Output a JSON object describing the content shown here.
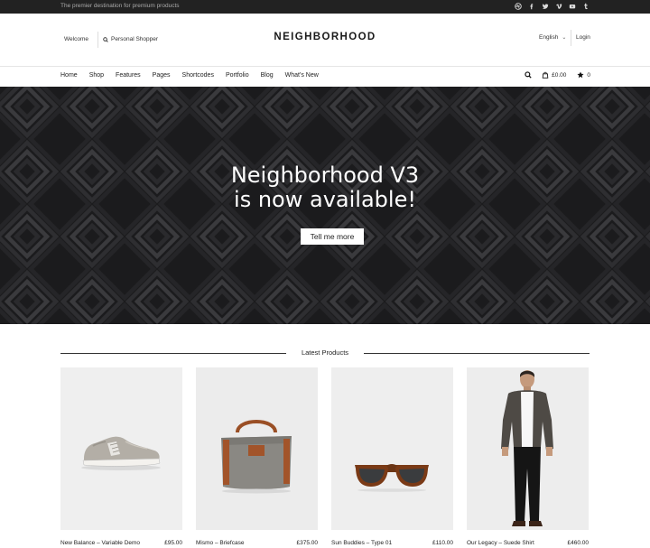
{
  "topbar": {
    "tagline": "The premier destination for premium products",
    "social_icons": [
      "dribbble-icon",
      "facebook-icon",
      "twitter-icon",
      "vimeo-icon",
      "youtube-icon",
      "tumblr-icon"
    ]
  },
  "header": {
    "welcome": "Welcome",
    "personal_shopper": "Personal Shopper",
    "logo": "NEIGHBORHOOD",
    "language": "English",
    "login": "Login"
  },
  "nav": {
    "items": [
      "Home",
      "Shop",
      "Features",
      "Pages",
      "Shortcodes",
      "Portfolio",
      "Blog",
      "What's New"
    ],
    "cart_total": "£0.00",
    "wishlist_count": "0"
  },
  "hero": {
    "title_line1": "Neighborhood V3",
    "title_line2": "is now available!",
    "button": "Tell me more"
  },
  "latest": {
    "title": "Latest Products",
    "products": [
      {
        "name": "New Balance – Variable Demo",
        "price": "£95.00"
      },
      {
        "name": "Mismo – Briefcase",
        "price": "£375.00"
      },
      {
        "name": "Sun Buddies – Type 01",
        "price": "£110.00"
      },
      {
        "name": "Our Legacy – Suede Shirt",
        "price": "£460.00"
      }
    ]
  },
  "colors": {
    "topbar_bg": "#222222",
    "hero_bg": "#1b1b1d",
    "text": "#222222"
  }
}
